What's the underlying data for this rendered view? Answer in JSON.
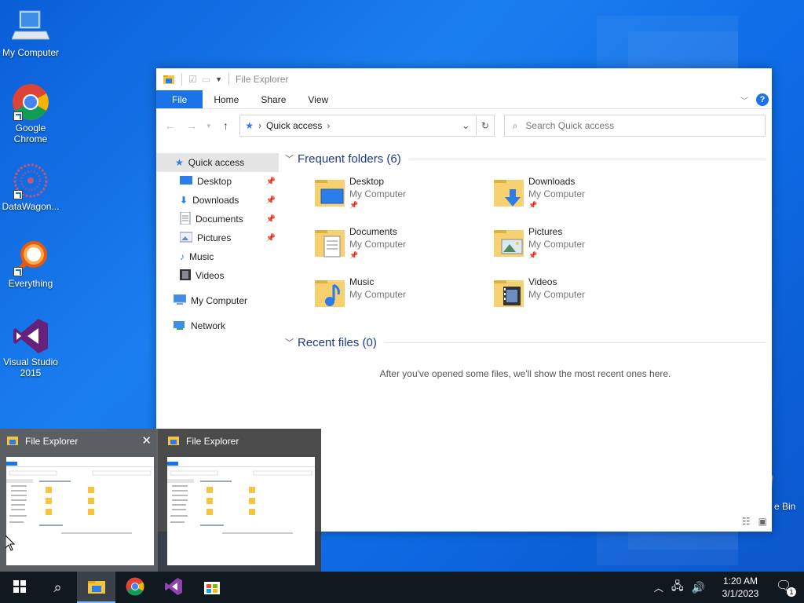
{
  "desktop": {
    "icons": [
      {
        "label": "My Computer"
      },
      {
        "label": "Google Chrome"
      },
      {
        "label": "DataWagon..."
      },
      {
        "label": "Everything"
      },
      {
        "label": "Visual Studio 2015"
      }
    ],
    "recycle_partial": "e Bin"
  },
  "explorer": {
    "title": "File Explorer",
    "ribbon_tabs": [
      "File",
      "Home",
      "Share",
      "View"
    ],
    "help": "?",
    "address": "Quick access",
    "search_placeholder": "Search Quick access",
    "nav": [
      {
        "label": "Quick access"
      },
      {
        "label": "Desktop"
      },
      {
        "label": "Downloads"
      },
      {
        "label": "Documents"
      },
      {
        "label": "Pictures"
      },
      {
        "label": "Music"
      },
      {
        "label": "Videos"
      },
      {
        "label": "My Computer"
      },
      {
        "label": "Network"
      }
    ],
    "frequent_header": "Frequent folders (6)",
    "folders": [
      {
        "name": "Desktop",
        "sub": "My Computer"
      },
      {
        "name": "Downloads",
        "sub": "My Computer"
      },
      {
        "name": "Documents",
        "sub": "My Computer"
      },
      {
        "name": "Pictures",
        "sub": "My Computer"
      },
      {
        "name": "Music",
        "sub": "My Computer"
      },
      {
        "name": "Videos",
        "sub": "My Computer"
      }
    ],
    "recent_header": "Recent files (0)",
    "recent_empty": "After you've opened some files, we'll show the most recent ones here."
  },
  "thumbnails": [
    {
      "title": "File Explorer"
    },
    {
      "title": "File Explorer"
    }
  ],
  "taskbar": {
    "time": "1:20 AM",
    "date": "3/1/2023",
    "notification_count": "1"
  }
}
